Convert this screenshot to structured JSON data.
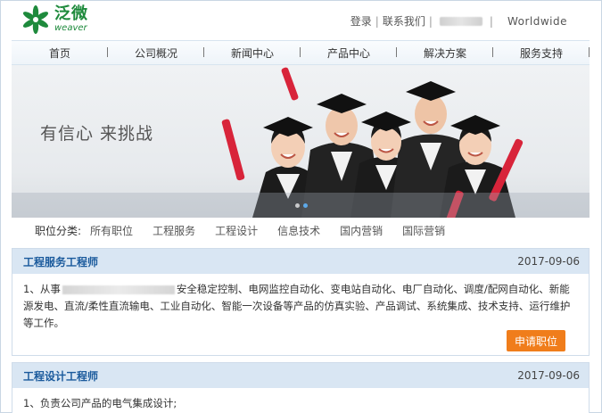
{
  "brand": {
    "name_cn": "泛微",
    "name_en": "weaver",
    "green": "#1e8a3c"
  },
  "top_links": {
    "login": "登录",
    "contact": "联系我们",
    "worldwide": "Worldwide"
  },
  "nav": {
    "items": [
      "首页",
      "公司概况",
      "新闻中心",
      "产品中心",
      "解决方案",
      "服务支持"
    ]
  },
  "banner": {
    "slogan": "有信心  来挑战"
  },
  "categories": {
    "label": "职位分类:",
    "items": [
      "所有职位",
      "工程服务",
      "工程设计",
      "信息技术",
      "国内营销",
      "国际营销"
    ]
  },
  "jobs": [
    {
      "title": "工程服务工程师",
      "date": "2017-09-06",
      "desc_prefix": "1、从事",
      "desc_rest": "安全稳定控制、电网监控自动化、变电站自动化、电厂自动化、调度/配网自动化、新能源发电、直流/柔性直流输电、工业自动化、智能一次设备等产品的仿真实验、产品调试、系统集成、技术支持、运行维护等工作。",
      "apply_label": "申请职位"
    },
    {
      "title": "工程设计工程师",
      "date": "2017-09-06",
      "desc": "1、负责公司产品的电气集成设计;"
    }
  ],
  "colors": {
    "accent_orange": "#f07d1b",
    "header_blue": "#d9e6f3",
    "title_blue": "#1a5a9c"
  }
}
